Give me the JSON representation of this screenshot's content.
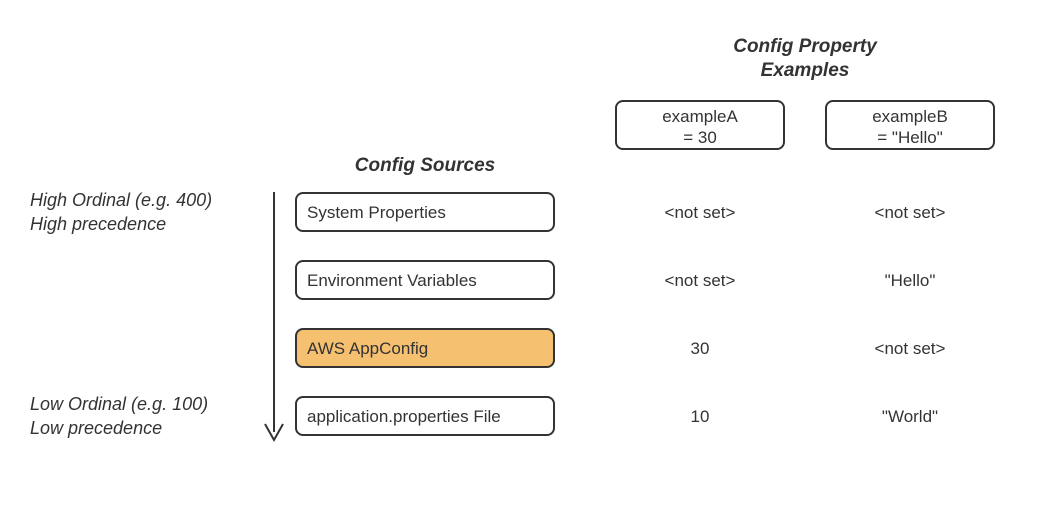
{
  "headings": {
    "examples_title_line1": "Config Property",
    "examples_title_line2": "Examples",
    "sources_title": "Config Sources"
  },
  "properties": {
    "a": {
      "name": "exampleA",
      "value_display": "= 30"
    },
    "b": {
      "name": "exampleB",
      "value_display": "= \"Hello\""
    }
  },
  "ordinal": {
    "high_line1": "High Ordinal (e.g. 400)",
    "high_line2": "High precedence",
    "low_line1": "Low Ordinal (e.g. 100)",
    "low_line2": "Low precedence"
  },
  "sources": [
    {
      "label": "System Properties",
      "highlight": false,
      "a": "<not set>",
      "b": "<not set>"
    },
    {
      "label": "Environment Variables",
      "highlight": false,
      "a": "<not set>",
      "b": "\"Hello\""
    },
    {
      "label": "AWS AppConfig",
      "highlight": true,
      "a": "30",
      "b": "<not set>"
    },
    {
      "label": "application.properties File",
      "highlight": false,
      "a": "10",
      "b": "\"World\""
    }
  ],
  "colors": {
    "highlight_fill": "#f5c171",
    "stroke": "#333333"
  }
}
